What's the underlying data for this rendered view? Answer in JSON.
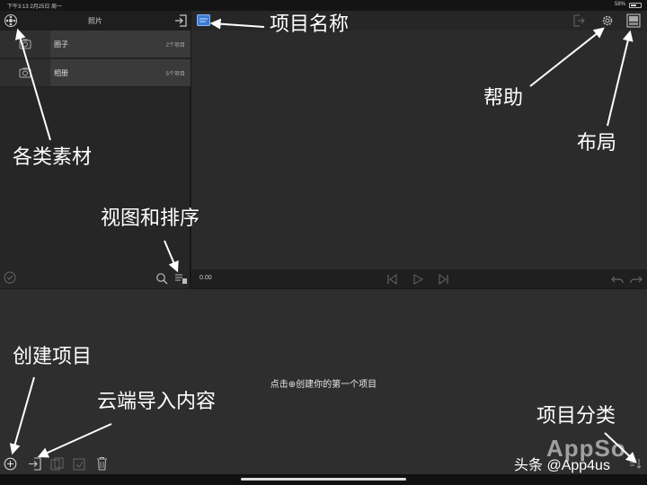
{
  "status_bar": {
    "time": "下午3:13  2月25日 周一",
    "battery": "58%"
  },
  "left_panel": {
    "title": "照片",
    "items": [
      {
        "name": "圈子",
        "count": "2个项目"
      },
      {
        "name": "相册",
        "count": "5个项目"
      }
    ]
  },
  "transport": {
    "timecode": "0.00"
  },
  "browser": {
    "empty_message": "点击⊕创建你的第一个项目"
  },
  "callouts": {
    "assets": "各类素材",
    "project_name": "项目名称",
    "help": "帮助",
    "layout": "布局",
    "view_sort": "视图和排序",
    "create_project": "创建项目",
    "cloud_import": "云端导入内容",
    "project_category": "项目分类"
  },
  "watermark": {
    "logo": "AppSo",
    "source": "头条 @App4us"
  },
  "colors": {
    "panel": "#262626",
    "viewer": "#2b2b2b",
    "browser": "#2e2e2e",
    "accent": "#3a7bd5"
  }
}
